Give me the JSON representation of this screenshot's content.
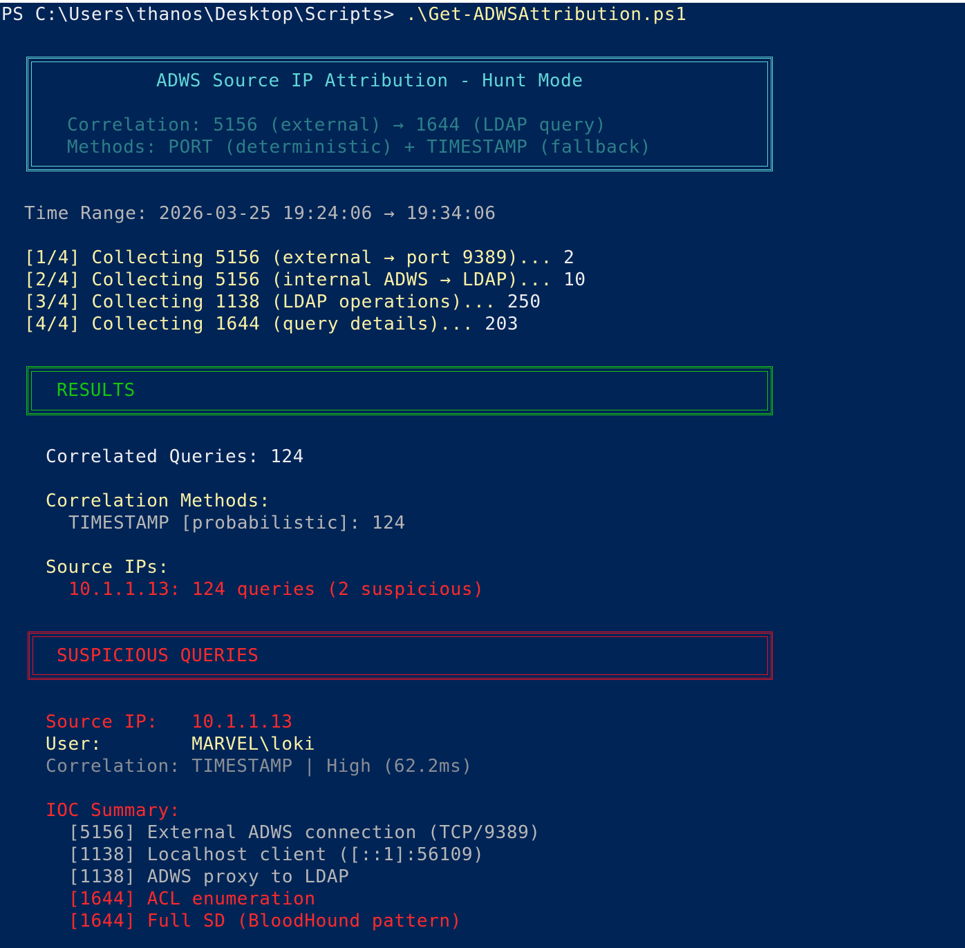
{
  "prompt": {
    "path": "PS C:\\Users\\thanos\\Desktop\\Scripts> ",
    "command": ".\\Get-ADWSAttribution.ps1"
  },
  "banner": {
    "title": "ADWS Source IP Attribution - Hunt Mode",
    "correlation": "Correlation: 5156 (external) → 1644 (LDAP query)",
    "methods": "Methods: PORT (deterministic) + TIMESTAMP (fallback)"
  },
  "time_range": "Time Range: 2026-03-25 19:24:06 → 19:34:06",
  "steps": [
    {
      "label": "[1/4] Collecting 5156 (external → port 9389)... ",
      "count": "2"
    },
    {
      "label": "[2/4] Collecting 5156 (internal ADWS → LDAP)... ",
      "count": "10"
    },
    {
      "label": "[3/4] Collecting 1138 (LDAP operations)... ",
      "count": "250"
    },
    {
      "label": "[4/4] Collecting 1644 (query details)... ",
      "count": "203"
    }
  ],
  "results": {
    "header": "RESULTS",
    "correlated_label": "Correlated Queries: ",
    "correlated_value": "124",
    "methods_label": "Correlation Methods:",
    "method_line": "TIMESTAMP [probabilistic]: 124",
    "source_ips_label": "Source IPs:",
    "source_ip_line": "10.1.1.13: 124 queries (2 suspicious)"
  },
  "suspicious": {
    "header": "SUSPICIOUS QUERIES",
    "source_ip_label": "Source IP:   ",
    "source_ip_value": "10.1.1.13",
    "user_label": "User:        ",
    "user_value": "MARVEL\\loki",
    "correlation_line": "Correlation: TIMESTAMP | High (62.2ms)",
    "ioc_label": "IOC Summary:",
    "iocs": [
      {
        "text": "[5156] External ADWS connection (TCP/9389)",
        "severity": "normal"
      },
      {
        "text": "[1138] Localhost client ([::1]:56109)",
        "severity": "normal"
      },
      {
        "text": "[1138] ADWS proxy to LDAP",
        "severity": "normal"
      },
      {
        "text": "[1644] ACL enumeration",
        "severity": "high"
      },
      {
        "text": "[1644] Full SD (BloodHound pattern)",
        "severity": "high"
      }
    ]
  },
  "colors": {
    "background": "#012456",
    "cyan": "#61d6d6",
    "green": "#16c60c",
    "red": "#e81123",
    "yellow": "#f9f1a5"
  }
}
